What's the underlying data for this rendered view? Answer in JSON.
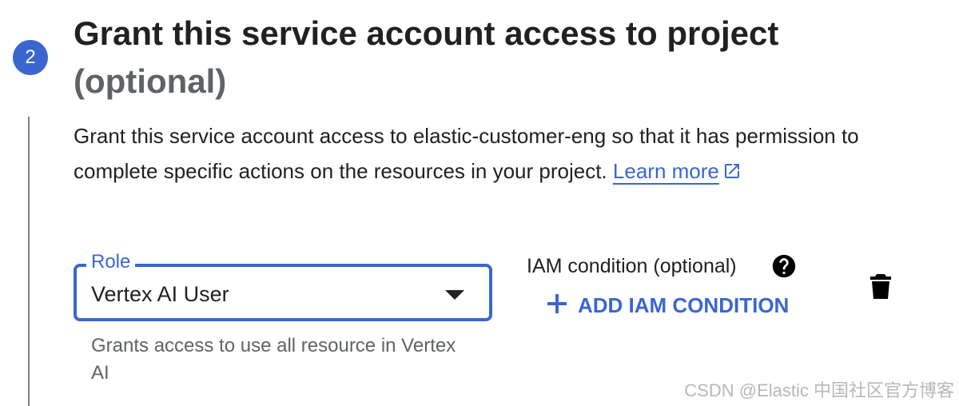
{
  "step": {
    "number": "2",
    "title": "Grant this service account access to project",
    "title_optional": "(optional)"
  },
  "description": {
    "text": "Grant this service account access to elastic-customer-eng so that it has permission to complete specific actions on the resources in your project.",
    "link_label": "Learn more"
  },
  "role_field": {
    "label": "Role",
    "value": "Vertex AI User",
    "help_text": "Grants access to use all resource in Vertex AI"
  },
  "iam_condition": {
    "heading": "IAM condition (optional)",
    "add_button_label": "ADD IAM CONDITION"
  },
  "icons": {
    "external_link": "external-link-icon",
    "dropdown": "chevron-down-icon",
    "help": "help-icon",
    "add": "plus-icon",
    "delete": "trash-icon"
  },
  "colors": {
    "accent": "#3b66d0",
    "text": "#202124",
    "secondary_text": "#5f6368"
  },
  "watermark": "CSDN @Elastic 中国社区官方博客"
}
